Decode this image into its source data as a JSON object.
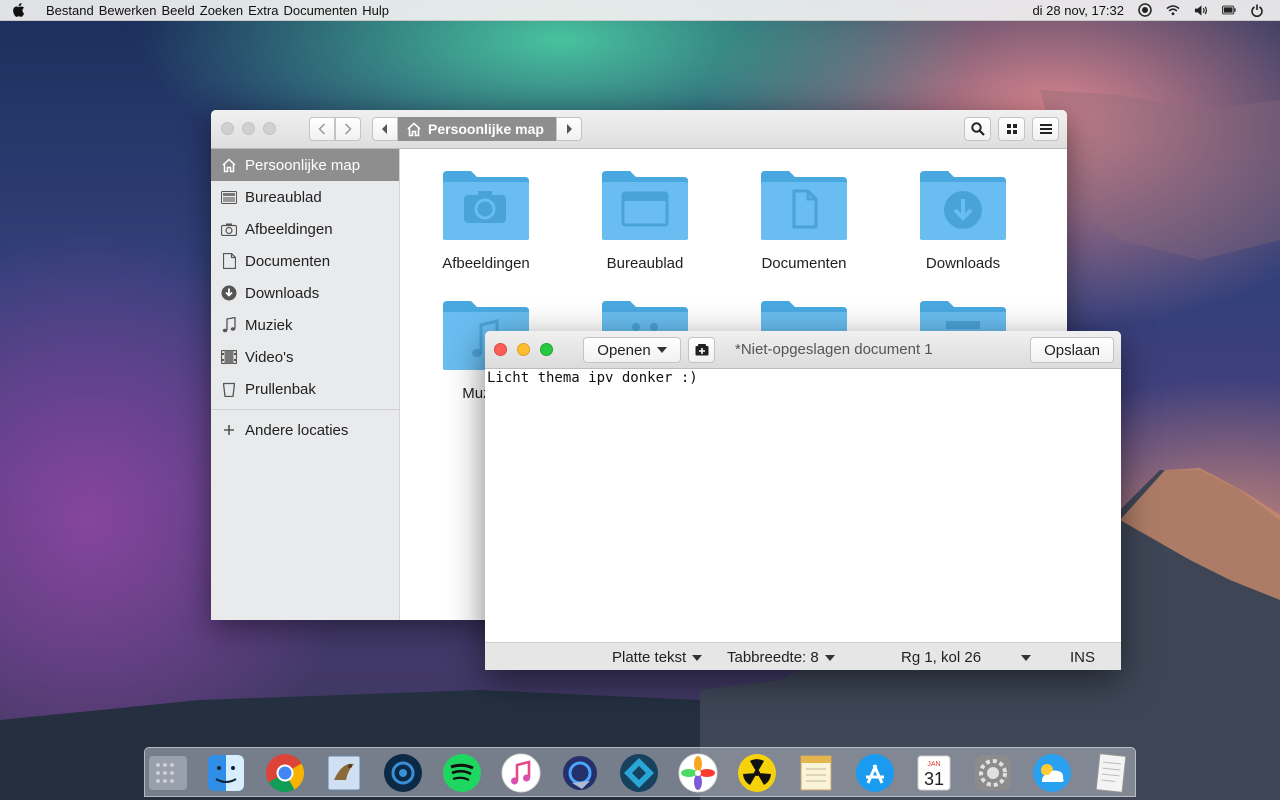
{
  "menubar": {
    "items": [
      "Bestand",
      "Bewerken",
      "Beeld",
      "Zoeken",
      "Extra",
      "Documenten",
      "Hulp"
    ],
    "clock": "di 28 nov, 17:32"
  },
  "file_manager": {
    "path_current": "Persoonlijke map",
    "sidebar": {
      "items": [
        {
          "label": "Persoonlijke map",
          "icon": "home-icon"
        },
        {
          "label": "Bureaublad",
          "icon": "desktop-icon"
        },
        {
          "label": "Afbeeldingen",
          "icon": "camera-icon"
        },
        {
          "label": "Documenten",
          "icon": "document-icon"
        },
        {
          "label": "Downloads",
          "icon": "download-icon"
        },
        {
          "label": "Muziek",
          "icon": "music-note-icon"
        },
        {
          "label": "Video's",
          "icon": "film-icon"
        },
        {
          "label": "Prullenbak",
          "icon": "trash-icon"
        }
      ],
      "other_locations": "Andere locaties"
    },
    "folders": [
      "Afbeeldingen",
      "Bureaublad",
      "Documenten",
      "Downloads",
      "Muziek"
    ]
  },
  "editor": {
    "open_label": "Openen",
    "title": "*Niet-opgeslagen document 1",
    "save_label": "Opslaan",
    "content": "Licht thema ipv donker :)",
    "status": {
      "language": "Platte tekst",
      "tab_width": "Tabbreedte: 8",
      "position": "Rg 1, kol 26",
      "mode": "INS"
    }
  },
  "dock": {
    "apps": [
      "launchpad-icon",
      "finder-icon",
      "chrome-icon",
      "mail-icon",
      "steam-icon",
      "spotify-icon",
      "itunes-icon",
      "browser-icon",
      "kodi-icon",
      "photos-icon",
      "radiation-icon",
      "notes-icon",
      "app-store-icon",
      "calendar-icon",
      "system-preferences-icon",
      "weather-icon",
      "text-editor-icon"
    ],
    "calendar_month": "JAN",
    "calendar_day": "31"
  },
  "colors": {
    "folder_blue": "#5fb8eb",
    "selection_grey": "#8e8e8e",
    "close_red": "#fc5f57",
    "minimize_yellow": "#fdbd2e",
    "maximize_green": "#28c840"
  }
}
